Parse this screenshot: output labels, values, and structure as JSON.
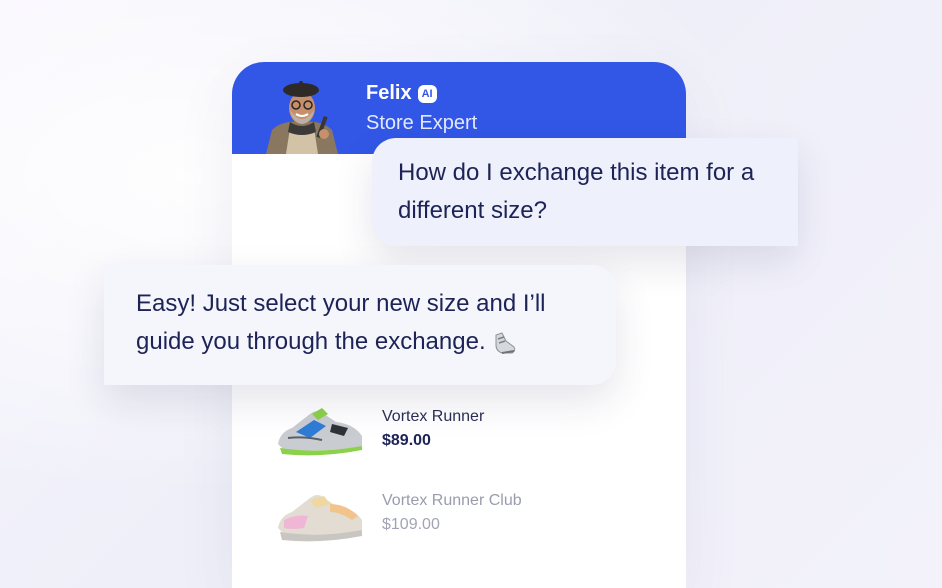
{
  "agent": {
    "name": "Felix",
    "badge": "AI",
    "role": "Store Expert"
  },
  "messages": {
    "user": " How do I exchange this item for a different size?",
    "agent": " Easy! Just select your new size and I’ll guide you through the exchange."
  },
  "products": [
    {
      "name": "Vortex Runner",
      "price": "$89.00"
    },
    {
      "name": "Vortex Runner Club",
      "price": "$109.00"
    }
  ],
  "colors": {
    "header": "#3257e6",
    "text": "#1d2356"
  },
  "icons": {
    "avatar": "person-avatar",
    "shoe": "sneaker-icon"
  }
}
